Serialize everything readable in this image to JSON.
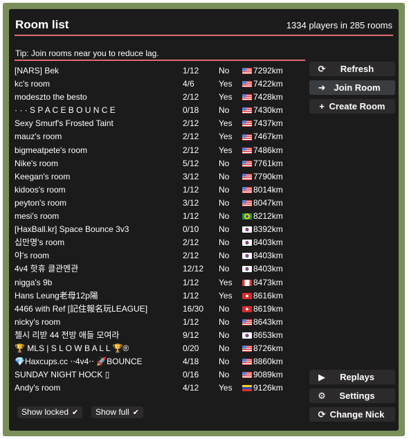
{
  "header": {
    "title": "Room list",
    "summary": "1334 players in 285 rooms"
  },
  "tip": "Tip: Join rooms near you to reduce lag.",
  "rooms": [
    {
      "name": "[NARS] Bek",
      "players": "1/12",
      "pass": "No",
      "flag": "us",
      "dist": "7292km"
    },
    {
      "name": "kc's room",
      "players": "4/6",
      "pass": "Yes",
      "flag": "us",
      "dist": "7422km"
    },
    {
      "name": "modeszto the besto",
      "players": "2/12",
      "pass": "Yes",
      "flag": "us",
      "dist": "7428km"
    },
    {
      "name": "· · · S P A C E B O U N C E",
      "players": "0/18",
      "pass": "No",
      "flag": "us",
      "dist": "7430km"
    },
    {
      "name": "Sexy Smurf's Frosted Taint",
      "players": "2/12",
      "pass": "Yes",
      "flag": "us",
      "dist": "7437km"
    },
    {
      "name": "mauz's room",
      "players": "2/12",
      "pass": "Yes",
      "flag": "us",
      "dist": "7467km"
    },
    {
      "name": "bigmeatpete's room",
      "players": "2/12",
      "pass": "Yes",
      "flag": "us",
      "dist": "7486km"
    },
    {
      "name": "Nike's room",
      "players": "5/12",
      "pass": "No",
      "flag": "us",
      "dist": "7761km"
    },
    {
      "name": "Keegan's room",
      "players": "3/12",
      "pass": "No",
      "flag": "us",
      "dist": "7790km"
    },
    {
      "name": "kidoos's room",
      "players": "1/12",
      "pass": "No",
      "flag": "us",
      "dist": "8014km"
    },
    {
      "name": "peyton's room",
      "players": "3/12",
      "pass": "No",
      "flag": "us",
      "dist": "8047km"
    },
    {
      "name": "mesi's room",
      "players": "1/12",
      "pass": "No",
      "flag": "br",
      "dist": "8212km"
    },
    {
      "name": "[HaxBall.kr] Space Bounce 3v3",
      "players": "0/10",
      "pass": "No",
      "flag": "kr",
      "dist": "8392km"
    },
    {
      "name": "십만명's room",
      "players": "2/12",
      "pass": "No",
      "flag": "kr",
      "dist": "8403km"
    },
    {
      "name": "야's room",
      "players": "2/12",
      "pass": "No",
      "flag": "kr",
      "dist": "8403km"
    },
    {
      "name": "4v4 핫휴 클관멘관",
      "players": "12/12",
      "pass": "No",
      "flag": "kr",
      "dist": "8403km"
    },
    {
      "name": "nigga's 9b",
      "players": "1/12",
      "pass": "Yes",
      "flag": "ca",
      "dist": "8473km"
    },
    {
      "name": "Hans Leung老母12p陽",
      "players": "1/12",
      "pass": "Yes",
      "flag": "hk",
      "dist": "8616km"
    },
    {
      "name": "4466 with Ref [記住報名玩LEAGUE]",
      "players": "16/30",
      "pass": "No",
      "flag": "hk",
      "dist": "8619km"
    },
    {
      "name": "nicky's room",
      "players": "1/12",
      "pass": "No",
      "flag": "us",
      "dist": "8643km"
    },
    {
      "name": "첼시 리받 44 전방 애들 모여라",
      "players": "9/12",
      "pass": "No",
      "flag": "kr",
      "dist": "8653km"
    },
    {
      "name": "🏆 MLS | S L O W B A L L 🏆®",
      "players": "0/20",
      "pass": "No",
      "flag": "us",
      "dist": "8726km"
    },
    {
      "name": "💎Haxcups.cc ⋅⋅4v4⋅⋅ 🚀BOUNCE",
      "players": "4/18",
      "pass": "No",
      "flag": "us",
      "dist": "8860km"
    },
    {
      "name": "SUNDAY NIGHT HOCK ▯",
      "players": "0/16",
      "pass": "No",
      "flag": "us",
      "dist": "9089km"
    },
    {
      "name": "Andy's room",
      "players": "4/12",
      "pass": "Yes",
      "flag": "ve",
      "dist": "9126km"
    }
  ],
  "buttons": {
    "refresh": "Refresh",
    "join": "Join Room",
    "create": "Create Room",
    "replays": "Replays",
    "settings": "Settings",
    "change_nick": "Change Nick"
  },
  "toggles": {
    "show_locked": "Show locked",
    "show_full": "Show full"
  },
  "colors": {
    "frame": "#7b8f5b",
    "panel": "#1c1b1c",
    "accent_line": "#e06c6c",
    "button": "#2c2a2a"
  }
}
